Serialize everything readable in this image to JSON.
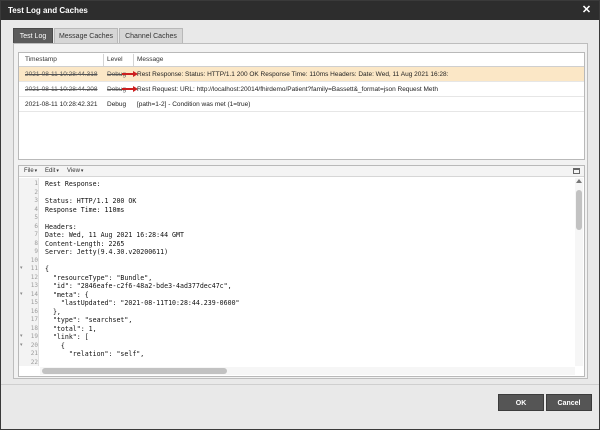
{
  "window": {
    "title": "Test Log and Caches",
    "close_icon": "close-icon"
  },
  "tabs": [
    {
      "label": "Test Log",
      "active": true
    },
    {
      "label": "Message Caches",
      "active": false
    },
    {
      "label": "Channel Caches",
      "active": false
    }
  ],
  "log": {
    "columns": [
      "Timestamp",
      "Level",
      "Message"
    ],
    "rows": [
      {
        "timestamp": "2021-08-11 10:28:44.318",
        "level": "Debug",
        "message": "Rest Response: Status: HTTP/1.1 200 OK Response Time: 110ms Headers: Date: Wed, 11 Aug 2021 16:28:",
        "selected": true,
        "struck": true
      },
      {
        "timestamp": "2021-08-11 10:28:44.208",
        "level": "Debug",
        "message": "Rest Request: URL: http://localhost:20014/fhirdemo/Patient?family=Bassett&_format=json Request Meth",
        "selected": false,
        "struck": true
      },
      {
        "timestamp": "2021-08-11 10:28:42.321",
        "level": "Debug",
        "message": "[path=1-2] - Condition was met (1=true)",
        "selected": false,
        "struck": false
      }
    ]
  },
  "editor": {
    "menus": [
      "File",
      "Edit",
      "View"
    ],
    "lines": [
      "Rest Response:",
      "",
      "Status: HTTP/1.1 200 OK",
      "Response Time: 110ms",
      "",
      "Headers:",
      "Date: Wed, 11 Aug 2021 16:28:44 GMT",
      "Content-Length: 2265",
      "Server: Jetty(9.4.30.v20200611)",
      "",
      "{",
      "  \"resourceType\": \"Bundle\",",
      "  \"id\": \"2846eafe-c2f6-48a2-bde3-4ad377dec47c\",",
      "  \"meta\": {",
      "    \"lastUpdated\": \"2021-08-11T10:28:44.239-0600\"",
      "  },",
      "  \"type\": \"searchset\",",
      "  \"total\": 1,",
      "  \"link\": [",
      "    {",
      "      \"relation\": \"self\",",
      ""
    ]
  },
  "buttons": {
    "ok": "OK",
    "cancel": "Cancel"
  },
  "colors": {
    "selected_row": "#fbe7c6",
    "arrow": "#cc1f1f",
    "titlebar": "#2d2d2d"
  }
}
